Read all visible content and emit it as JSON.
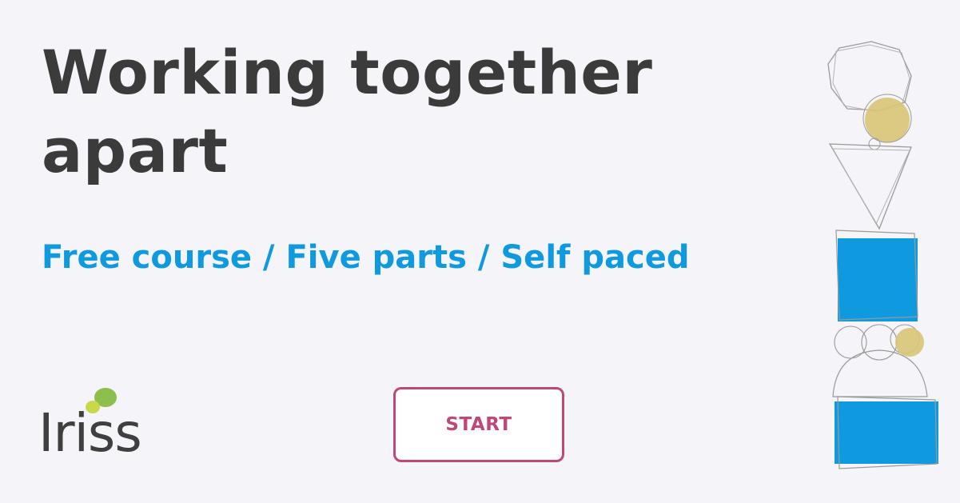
{
  "headline": {
    "line1": "Working together",
    "line2": "apart"
  },
  "subline": "Free course / Five parts / Self paced",
  "logo": {
    "text": "Iriss",
    "icon": "speech-bubbles-icon",
    "colors": {
      "green": "#8cbf4b",
      "yellow_green": "#c9d848",
      "text": "#3f3f3f"
    }
  },
  "start_button": {
    "label": "START"
  },
  "colors": {
    "background": "#f5f4f9",
    "headline": "#3b3b3b",
    "accent_blue": "#0f9ae0",
    "button": "#c0477a",
    "ochre": "#d9c574"
  }
}
